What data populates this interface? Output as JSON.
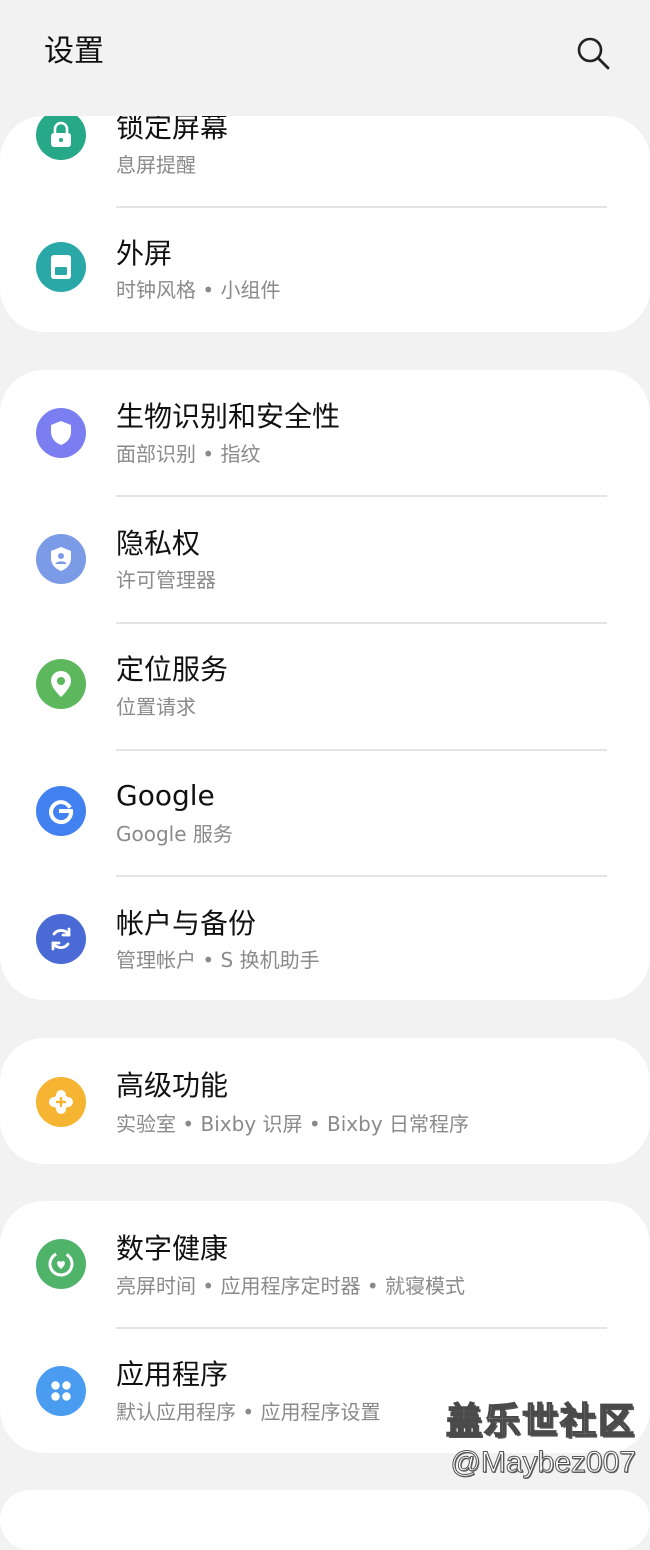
{
  "header": {
    "title": "设置",
    "search_icon": "search-icon"
  },
  "colors": {
    "background": "#f2f2f2",
    "card": "#ffffff",
    "lock_screen": "#26a889",
    "cover_screen": "#2aa8a8",
    "biometrics": "#7b7ef0",
    "privacy": "#7b9be6",
    "location": "#5db85d",
    "google": "#4281f0",
    "accounts": "#4a6ad6",
    "advanced": "#f5b431",
    "wellbeing": "#4fb36a",
    "apps": "#4a9cf0"
  },
  "sections": [
    {
      "items": [
        {
          "title": "锁定屏幕",
          "subtitle": "息屏提醒",
          "icon": "lock-icon"
        },
        {
          "title": "外屏",
          "subtitle": "时钟风格 • 小组件",
          "icon": "cover-screen-icon"
        }
      ]
    },
    {
      "items": [
        {
          "title": "生物识别和安全性",
          "subtitle": "面部识别 • 指纹",
          "icon": "shield-icon"
        },
        {
          "title": "隐私权",
          "subtitle": "许可管理器",
          "icon": "privacy-icon"
        },
        {
          "title": "定位服务",
          "subtitle": "位置请求",
          "icon": "location-pin-icon"
        },
        {
          "title": "Google",
          "subtitle": "Google 服务",
          "icon": "google-g-icon"
        },
        {
          "title": "帐户与备份",
          "subtitle": "管理帐户 • S 换机助手",
          "icon": "sync-icon"
        }
      ]
    },
    {
      "items": [
        {
          "title": "高级功能",
          "subtitle": "实验室 • Bixby 识屏 • Bixby 日常程序",
          "icon": "puzzle-icon"
        }
      ]
    },
    {
      "items": [
        {
          "title": "数字健康",
          "subtitle": "亮屏时间 • 应用程序定时器 • 就寝模式",
          "icon": "heart-ring-icon"
        },
        {
          "title": "应用程序",
          "subtitle": "默认应用程序 • 应用程序设置",
          "icon": "app-grid-icon"
        }
      ]
    }
  ],
  "watermark": {
    "line1": "盖乐世社区",
    "line2": "@Maybez007"
  }
}
